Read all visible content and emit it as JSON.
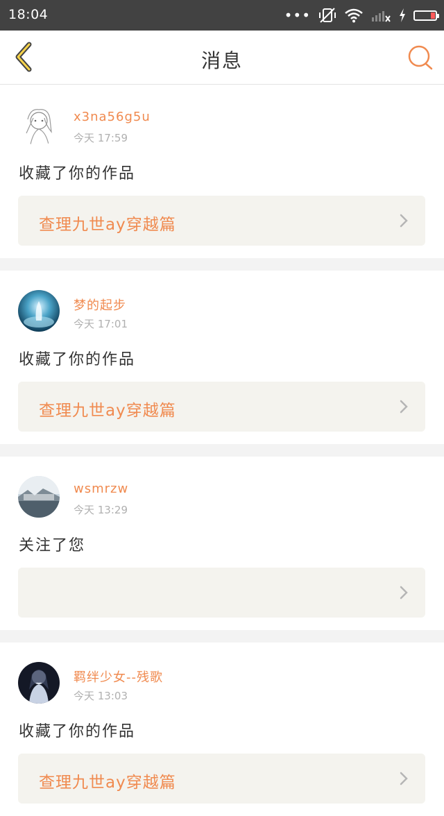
{
  "status_bar": {
    "time": "18:04",
    "icons": [
      "more-dots-icon",
      "vibrate-off-icon",
      "wifi-icon",
      "cellular-no-signal-icon",
      "charging-icon",
      "battery-icon"
    ],
    "battery_color": "#ff5a5a"
  },
  "header": {
    "title": "消息",
    "back_icon": "chevron-left-icon",
    "search_icon": "search-icon",
    "accent_color": "#f08a4f"
  },
  "messages": [
    {
      "username": "x3na56g5u",
      "time": "今天 17:59",
      "action": "收藏了你的作品",
      "work_title": "查理九世ay穿越篇",
      "avatar_icon": "sketch-girl-avatar"
    },
    {
      "username": "梦的起步",
      "time": "今天 17:01",
      "action": "收藏了你的作品",
      "work_title": "查理九世ay穿越篇",
      "avatar_icon": "blue-water-avatar"
    },
    {
      "username": "wsmrzw",
      "time": "今天 13:29",
      "action": "关注了您",
      "work_title": "",
      "avatar_icon": "landscape-avatar"
    },
    {
      "username": "羁绊少女--残歌",
      "time": "今天 13:03",
      "action": "收藏了你的作品",
      "work_title": "查理九世ay穿越篇",
      "avatar_icon": "dark-anime-avatar"
    }
  ]
}
